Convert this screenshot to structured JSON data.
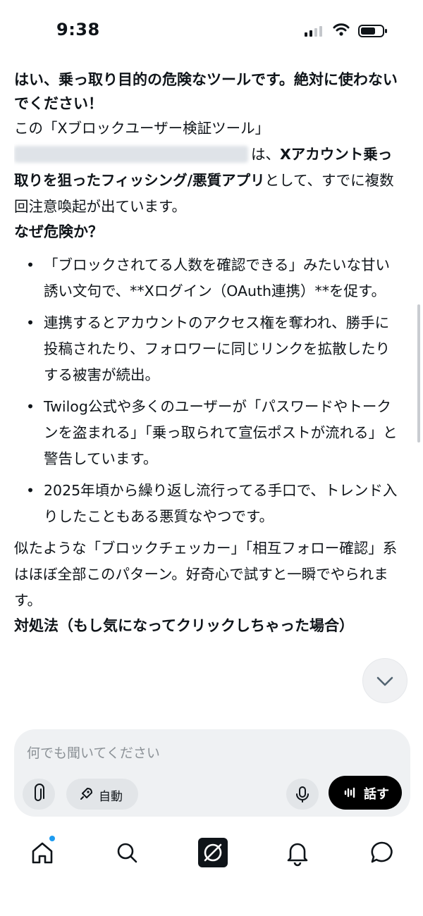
{
  "status_bar": {
    "time": "9:38"
  },
  "conversation": {
    "heading": "はい、乗っ取り目的の危険なツールです。絶対に使わないでください！",
    "intro": {
      "part1": "この「Xブロックユーザー検証ツール」",
      "part2": "は、",
      "part3_bold": "Xアカウント乗っ取りを狙ったフィッシング/悪質アプリ",
      "part4": "として、すでに複数回注意喚起が出ています。"
    },
    "section_heading": "なぜ危険か？",
    "bullet_symbol": "•",
    "bullets": [
      "「ブロックされてる人数を確認できる」みたいな甘い誘い文句で、**Xログイン（OAuth連携）**を促す。",
      "連携するとアカウントのアクセス権を奪われ、勝手に投稿されたり、フォロワーに同じリンクを拡散したりする被害が続出。",
      "Twilog公式や多くのユーザーが「パスワードやトークンを盗まれる」「乗っ取られて宣伝ポストが流れる」と警告しています。",
      "2025年頃から繰り返し流行ってる手口で、トレンド入りしたこともある悪質なやつです。"
    ],
    "summary": "似たような「ブロックチェッカー」「相互フォロー確認」系はほぼ全部このパターン。好奇心で試すと一瞬でやられます。",
    "next_heading": "対処法（もし気になってクリックしちゃった場合）"
  },
  "composer": {
    "placeholder": "何でも聞いてください",
    "auto_label": "自動",
    "speak_label": "話す"
  },
  "icons": {
    "status": [
      "signal-icon",
      "wifi-icon",
      "battery-icon"
    ],
    "composer": [
      "paperclip-icon",
      "rocket-icon",
      "microphone-icon",
      "soundwave-icon"
    ],
    "nav": [
      "home-icon",
      "search-icon",
      "grok-icon",
      "bell-icon",
      "chat-icon"
    ],
    "scroll": "chevron-down-icon"
  },
  "colors": {
    "accent": "#1d9bf0",
    "text": "#0f1419",
    "composer_bg": "#eff1f3",
    "speak_button": "#000000"
  }
}
